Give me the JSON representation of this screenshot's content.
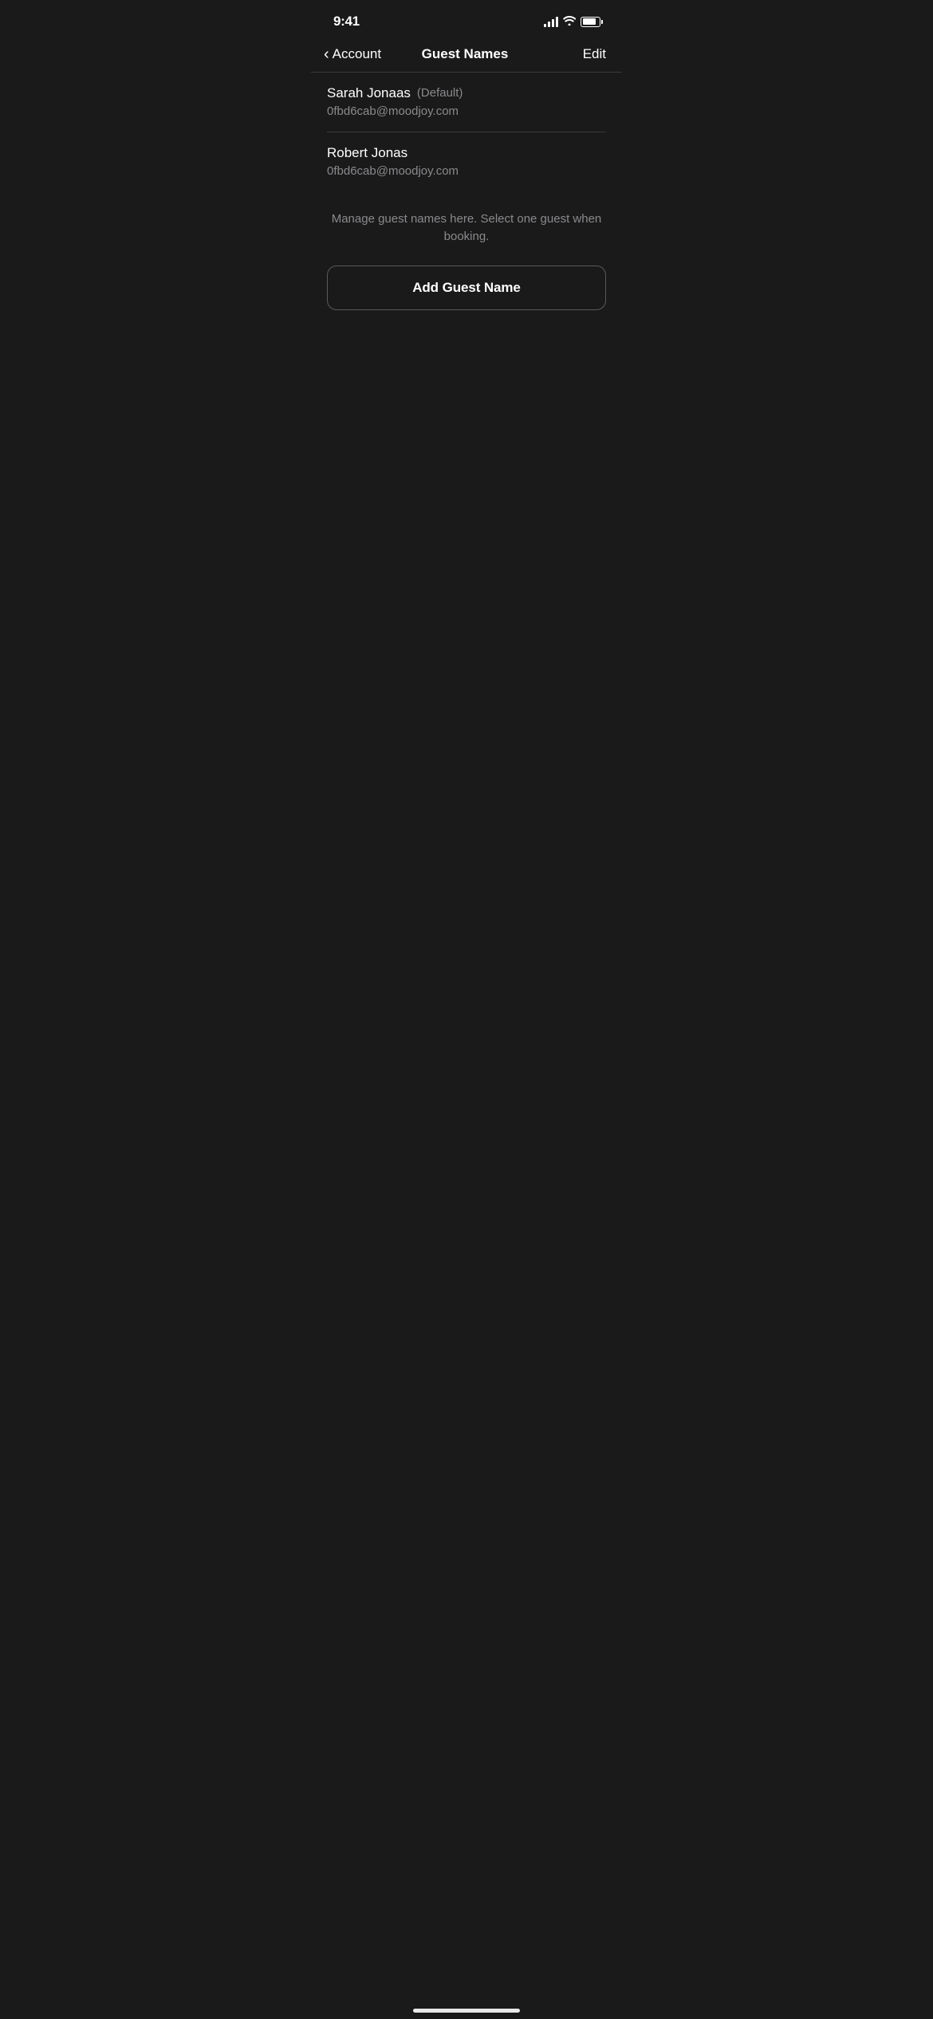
{
  "statusBar": {
    "time": "9:41",
    "batteryLevel": 80
  },
  "navBar": {
    "backLabel": "Account",
    "title": "Guest Names",
    "editLabel": "Edit"
  },
  "guests": [
    {
      "name": "Sarah Jonaas",
      "isDefault": true,
      "defaultLabel": "(Default)",
      "email": "0fbd6cab@moodjoy.com"
    },
    {
      "name": "Robert Jonas",
      "isDefault": false,
      "defaultLabel": "",
      "email": "0fbd6cab@moodjoy.com"
    }
  ],
  "infoText": "Manage guest names here. Select one guest when booking.",
  "addButtonLabel": "Add Guest Name"
}
